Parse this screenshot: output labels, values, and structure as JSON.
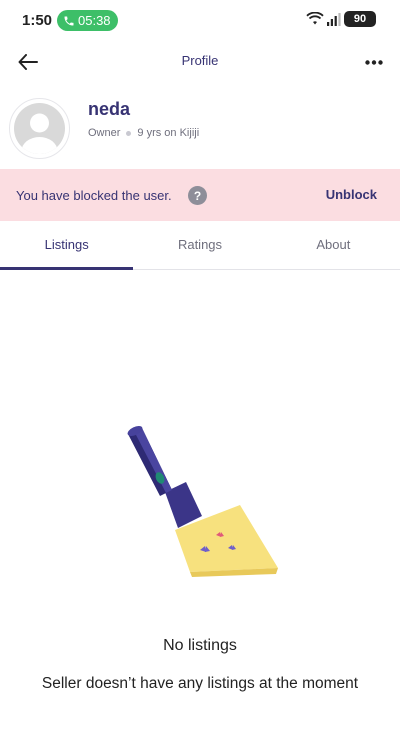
{
  "status_bar": {
    "time": "1:50",
    "call_timer": "05:38",
    "battery": "90"
  },
  "app_bar": {
    "title": "Profile"
  },
  "profile": {
    "name": "neda",
    "role": "Owner",
    "tenure": "9 yrs on Kijiji"
  },
  "blocked_banner": {
    "message": "You have blocked the user.",
    "help_symbol": "?",
    "action_label": "Unblock"
  },
  "tabs": [
    {
      "label": "Listings",
      "active": true
    },
    {
      "label": "Ratings",
      "active": false
    },
    {
      "label": "About",
      "active": false
    }
  ],
  "empty_state": {
    "title": "No listings",
    "subtitle": "Seller doesn’t have any listings at the moment",
    "illustration": "flashlight-illustration"
  },
  "colors": {
    "primary_text": "#373373",
    "banner_bg": "#fbdde1",
    "call_green": "#3dbf68",
    "flashlight_body": "#3b3588",
    "flashlight_beam": "#f7e17e"
  }
}
